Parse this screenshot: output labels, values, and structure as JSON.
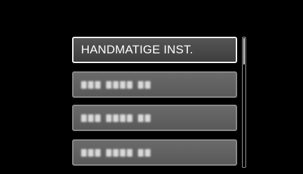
{
  "menu": {
    "items": [
      {
        "label": "HANDMATIGE INST.",
        "selected": true
      },
      {
        "label": "",
        "selected": false,
        "obscured": true
      },
      {
        "label": "",
        "selected": false,
        "obscured": true
      },
      {
        "label": "",
        "selected": false,
        "obscured": true
      }
    ]
  },
  "scrollbar": {
    "position_fraction": 0.0
  },
  "colors": {
    "background": "#000000",
    "selected_border": "#f2f2f2",
    "item_fill": "#626262"
  }
}
